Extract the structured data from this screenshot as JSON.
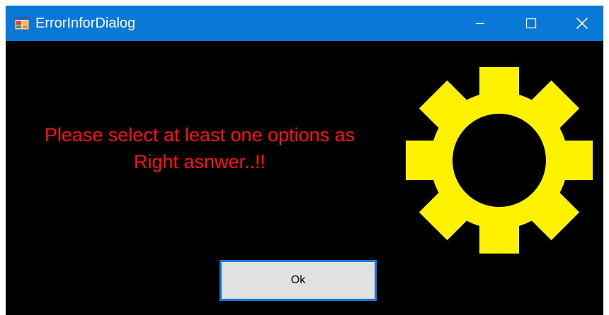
{
  "window": {
    "title": "ErrorInforDialog",
    "app_icon": "form-app-icon",
    "controls": {
      "minimize_icon": "minimize-icon",
      "maximize_icon": "maximize-icon",
      "close_icon": "close-icon"
    }
  },
  "dialog": {
    "message_line1": "Please select at least one options as",
    "message_line2": "Right asnwer..!!",
    "graphic_icon": "gear-icon",
    "ok_label": "Ok"
  },
  "colors": {
    "titlebar": "#0A78D7",
    "background": "#000000",
    "message_text": "#FF1010",
    "gear": "#FFF200",
    "button_face": "#E1E1E1",
    "button_border": "#1E78D8"
  }
}
